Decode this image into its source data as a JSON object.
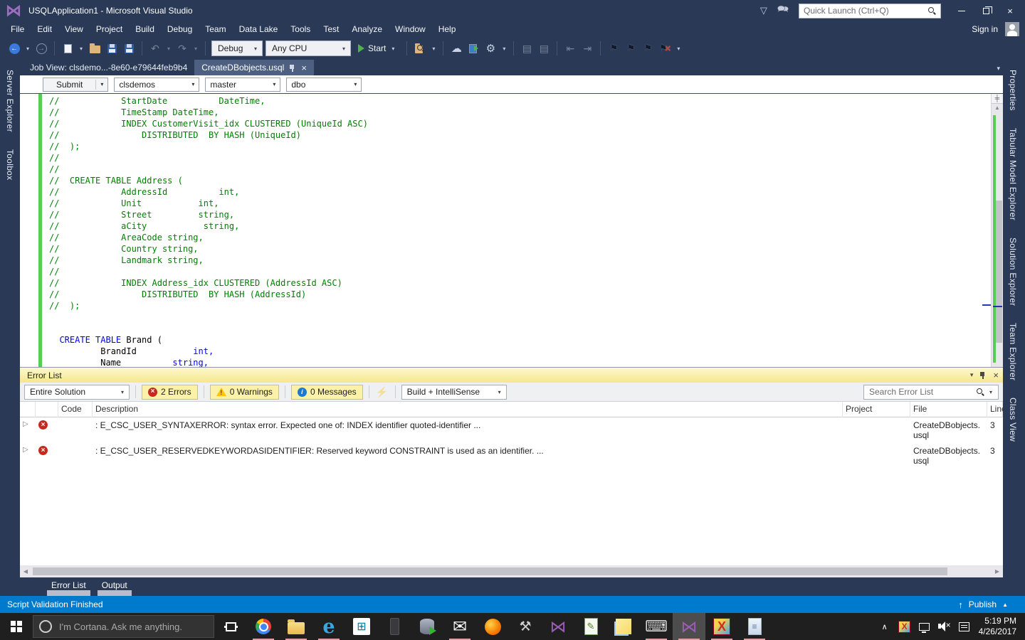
{
  "window": {
    "title": "USQLApplication1 - Microsoft Visual Studio",
    "quick_launch_placeholder": "Quick Launch (Ctrl+Q)",
    "sign_in_label": "Sign in"
  },
  "menu": {
    "items": [
      "File",
      "Edit",
      "View",
      "Project",
      "Build",
      "Debug",
      "Team",
      "Data Lake",
      "Tools",
      "Test",
      "Analyze",
      "Window",
      "Help"
    ]
  },
  "toolbar": {
    "debug_config": "Debug",
    "platform": "Any CPU",
    "start_label": "Start"
  },
  "doc_tabs": [
    {
      "label": "Job View: clsdemo...-8e60-e79644feb9b4"
    },
    {
      "label": "CreateDBobjects.usql"
    }
  ],
  "usql_bar": {
    "submit_label": "Submit",
    "account": "clsdemos",
    "database": "master",
    "schema": "dbo"
  },
  "left_tabs": [
    {
      "label": "Server Explorer"
    },
    {
      "label": "Toolbox"
    }
  ],
  "right_tabs": [
    {
      "label": "Properties"
    },
    {
      "label": "Tabular Model Explorer"
    },
    {
      "label": "Solution Explorer"
    },
    {
      "label": "Team Explorer"
    },
    {
      "label": "Class View"
    }
  ],
  "editor": {
    "lines": [
      [
        [
          "c",
          "//            StartDate          DateTime,"
        ]
      ],
      [
        [
          "c",
          "//            TimeStamp DateTime,"
        ]
      ],
      [
        [
          "c",
          "//            INDEX CustomerVisit_idx CLUSTERED (UniqueId ASC)"
        ]
      ],
      [
        [
          "c",
          "//                DISTRIBUTED  BY HASH (UniqueId)"
        ]
      ],
      [
        [
          "c",
          "//  );"
        ]
      ],
      [
        [
          "c",
          "//"
        ]
      ],
      [
        [
          "c",
          "//"
        ]
      ],
      [
        [
          "c",
          "//  CREATE TABLE Address ("
        ]
      ],
      [
        [
          "c",
          "//            AddressId          int,"
        ]
      ],
      [
        [
          "c",
          "//            Unit           int,"
        ]
      ],
      [
        [
          "c",
          "//            Street         string,"
        ]
      ],
      [
        [
          "c",
          "//            aCity           string,"
        ]
      ],
      [
        [
          "c",
          "//            AreaCode string,"
        ]
      ],
      [
        [
          "c",
          "//            Country string,"
        ]
      ],
      [
        [
          "c",
          "//            Landmark string,"
        ]
      ],
      [
        [
          "c",
          "//"
        ]
      ],
      [
        [
          "c",
          "//            INDEX Address_idx CLUSTERED (AddressId ASC)"
        ]
      ],
      [
        [
          "c",
          "//                DISTRIBUTED  BY HASH (AddressId)"
        ]
      ],
      [
        [
          "c",
          "//  );"
        ]
      ],
      [],
      [],
      [
        [
          "p",
          "  "
        ],
        [
          "k",
          "CREATE TABLE"
        ],
        [
          "p",
          " Brand ("
        ]
      ],
      [
        [
          "p",
          "          BrandId           "
        ],
        [
          "k",
          "int,"
        ]
      ],
      [
        [
          "p",
          "          Name          "
        ],
        [
          "k",
          "string,"
        ]
      ]
    ]
  },
  "error_list": {
    "title": "Error List",
    "scope": "Entire Solution",
    "errors_label": "2 Errors",
    "warnings_label": "0 Warnings",
    "messages_label": "0 Messages",
    "filter": "Build + IntelliSense",
    "search_placeholder": "Search Error List",
    "columns": {
      "code": "Code",
      "description": "Description",
      "project": "Project",
      "file": "File",
      "line": "Line"
    },
    "rows": [
      {
        "description": ": E_CSC_USER_SYNTAXERROR: syntax error. Expected one of: INDEX identifier quoted-identifier  ...",
        "project": "",
        "file": "CreateDBobjects.usql",
        "line": "3"
      },
      {
        "description": ": E_CSC_USER_RESERVEDKEYWORDASIDENTIFIER: Reserved keyword CONSTRAINT is used as an identifier. ...",
        "project": "",
        "file": "CreateDBobjects.usql",
        "line": "3"
      }
    ]
  },
  "panel_tabs": [
    {
      "label": "Error List"
    },
    {
      "label": "Output"
    }
  ],
  "status_bar": {
    "message": "Script Validation Finished",
    "publish_label": "Publish"
  },
  "taskbar": {
    "cortana_placeholder": "I'm Cortana. Ask me anything.",
    "clock": {
      "time": "5:19 PM",
      "date": "4/26/2017"
    },
    "icons": [
      {
        "name": "task-view-icon",
        "kind": "taskview",
        "glyph": ""
      },
      {
        "name": "chrome-icon",
        "kind": "chrome",
        "glyph": "",
        "running": true
      },
      {
        "name": "file-explorer-icon",
        "kind": "folder",
        "glyph": "",
        "running": true
      },
      {
        "name": "edge-icon",
        "kind": "edge",
        "glyph": "e",
        "running": true
      },
      {
        "name": "store-icon",
        "kind": "store",
        "glyph": "⊞"
      },
      {
        "name": "phone-icon",
        "kind": "phone",
        "glyph": ""
      },
      {
        "name": "sql-database-icon",
        "kind": "db",
        "glyph": ""
      },
      {
        "name": "mail-icon",
        "kind": "mail",
        "glyph": "✉",
        "running": true
      },
      {
        "name": "firefox-icon",
        "kind": "firefox",
        "glyph": ""
      },
      {
        "name": "sql-config-tools-icon",
        "kind": "tools",
        "glyph": "⚒"
      },
      {
        "name": "visual-studio-icon",
        "kind": "vs",
        "glyph": "⋈"
      },
      {
        "name": "recorder-app-icon",
        "kind": "doc",
        "glyph": "✎"
      },
      {
        "name": "sticky-notes-icon",
        "kind": "notes",
        "glyph": ""
      },
      {
        "name": "touch-keyboard-icon",
        "kind": "keyboard",
        "glyph": "⌨",
        "running": true
      },
      {
        "name": "visual-studio-active-icon",
        "kind": "vs",
        "glyph": "⋈",
        "running": true,
        "active": true
      },
      {
        "name": "xming-icon",
        "kind": "xming",
        "glyph": "X",
        "running": true
      },
      {
        "name": "notepad-icon",
        "kind": "notepad",
        "glyph": "≡",
        "running": true
      }
    ]
  }
}
